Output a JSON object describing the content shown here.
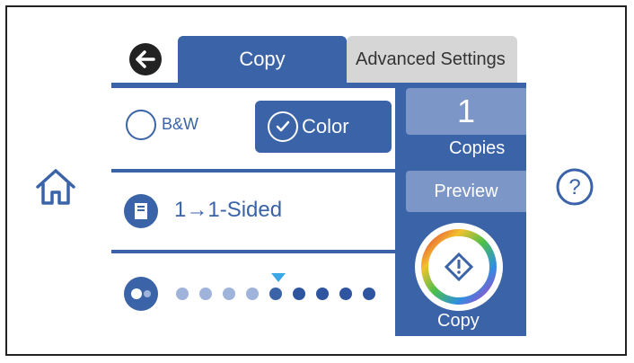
{
  "tabs": {
    "copy": "Copy",
    "advanced": "Advanced Settings"
  },
  "color_mode": {
    "bw_label": "B&W",
    "color_label": "Color"
  },
  "sided": {
    "label": "1→1-Sided"
  },
  "copies": {
    "count": "1",
    "label": "Copies"
  },
  "preview": {
    "label": "Preview"
  },
  "start": {
    "label": "Copy"
  },
  "density": {
    "level": 5,
    "steps": 9
  },
  "colors": {
    "accent": "#3a63a8",
    "light_accent": "#7d96c8",
    "marker": "#3aa7e6"
  },
  "icons": {
    "home": "home-icon",
    "help": "help-icon",
    "back": "back-arrow-icon"
  }
}
